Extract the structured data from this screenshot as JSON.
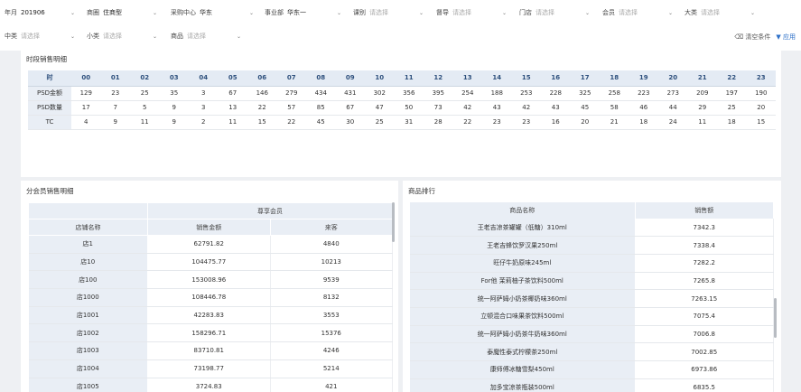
{
  "filters": [
    {
      "label": "年月",
      "value": "201906",
      "ph": false
    },
    {
      "label": "商圈",
      "value": "住商型",
      "ph": false
    },
    {
      "label": "采购中心",
      "value": "华东",
      "ph": false
    },
    {
      "label": "事业部",
      "value": "华东一",
      "ph": false
    },
    {
      "label": "课别",
      "value": "请选择",
      "ph": true
    },
    {
      "label": "督导",
      "value": "请选择",
      "ph": true
    },
    {
      "label": "门店",
      "value": "请选择",
      "ph": true
    },
    {
      "label": "会员",
      "value": "请选择",
      "ph": true
    },
    {
      "label": "大类",
      "value": "请选择",
      "ph": true
    },
    {
      "label": "中类",
      "value": "请选择",
      "ph": true
    },
    {
      "label": "小类",
      "value": "请选择",
      "ph": true
    },
    {
      "label": "商品",
      "value": "请选择",
      "ph": true
    }
  ],
  "actions": {
    "clear": "清空条件",
    "apply": "应用"
  },
  "hourly": {
    "title": "时段销售明细",
    "corner": "时",
    "hours": [
      "00",
      "01",
      "02",
      "03",
      "04",
      "05",
      "06",
      "07",
      "08",
      "09",
      "10",
      "11",
      "12",
      "13",
      "14",
      "15",
      "16",
      "17",
      "18",
      "19",
      "20",
      "21",
      "22",
      "23"
    ],
    "rows": [
      {
        "name": "PSD金额",
        "values": [
          129,
          23,
          25,
          35,
          3,
          67,
          146,
          279,
          434,
          431,
          302,
          356,
          395,
          254,
          188,
          253,
          228,
          325,
          258,
          223,
          273,
          209,
          197,
          190
        ]
      },
      {
        "name": "PSD数量",
        "values": [
          17,
          7,
          5,
          9,
          3,
          13,
          22,
          57,
          85,
          67,
          47,
          50,
          73,
          42,
          43,
          42,
          43,
          45,
          58,
          46,
          44,
          29,
          25,
          20
        ]
      },
      {
        "name": "TC",
        "values": [
          4,
          9,
          11,
          9,
          2,
          11,
          15,
          22,
          45,
          30,
          25,
          31,
          28,
          22,
          23,
          23,
          16,
          20,
          21,
          18,
          24,
          11,
          18,
          15
        ]
      }
    ]
  },
  "member": {
    "title": "分会员销售明细",
    "group": "尊享会员",
    "cols": [
      "店铺名称",
      "销售金额",
      "来客"
    ],
    "rows": [
      [
        "店1",
        "62791.82",
        "4840"
      ],
      [
        "店10",
        "104475.77",
        "10213"
      ],
      [
        "店100",
        "153008.96",
        "9539"
      ],
      [
        "店1000",
        "108446.78",
        "8132"
      ],
      [
        "店1001",
        "42283.83",
        "3553"
      ],
      [
        "店1002",
        "158296.71",
        "15376"
      ],
      [
        "店1003",
        "83710.81",
        "4246"
      ],
      [
        "店1004",
        "73198.77",
        "5214"
      ],
      [
        "店1005",
        "3724.83",
        "421"
      ]
    ]
  },
  "rank": {
    "title": "商品排行",
    "cols": [
      "商品名称",
      "销售额"
    ],
    "rows": [
      [
        "王老吉凉茶罐罐（低糖）310ml",
        "7342.3"
      ],
      [
        "王老吉蜂饮罗汉果250ml",
        "7338.4"
      ],
      [
        "旺仔牛奶原味245ml",
        "7282.2"
      ],
      [
        "For他 茉莉柚子茶饮料500ml",
        "7265.8"
      ],
      [
        "统一阿萨姆小奶茶椰奶味360ml",
        "7263.15"
      ],
      [
        "立顿混合口味果茶饮料500ml",
        "7075.4"
      ],
      [
        "统一阿萨姆小奶茶牛奶味360ml",
        "7006.8"
      ],
      [
        "泰魔性泰式柠檬茶250ml",
        "7002.85"
      ],
      [
        "康师傅冰糖雪梨450ml",
        "6973.86"
      ],
      [
        "加多宝凉茶瓶装500ml",
        "6835.5"
      ]
    ]
  }
}
